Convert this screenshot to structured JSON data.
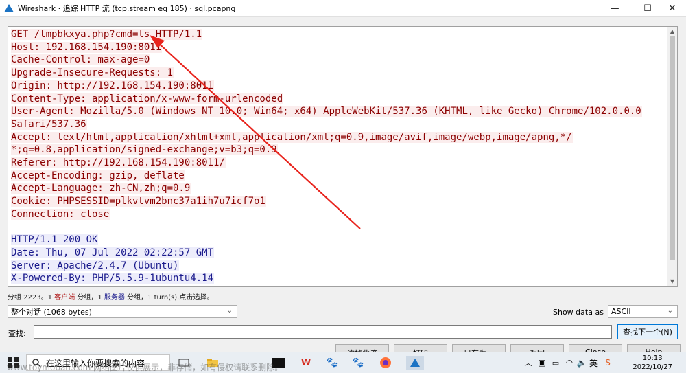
{
  "window": {
    "title": "Wireshark · 追踪 HTTP 流 (tcp.stream eq 185) · sql.pcapng",
    "controls": {
      "minimize": "—",
      "maximize": "☐",
      "close": "✕"
    }
  },
  "stream": {
    "client_lines": [
      "GET /tmpbkxya.php?cmd=ls HTTP/1.1",
      "Host: 192.168.154.190:8011",
      "Cache-Control: max-age=0",
      "Upgrade-Insecure-Requests: 1",
      "Origin: http://192.168.154.190:8011",
      "Content-Type: application/x-www-form-urlencoded",
      "User-Agent: Mozilla/5.0 (Windows NT 10.0; Win64; x64) AppleWebKit/537.36 (KHTML, like Gecko) Chrome/102.0.0.0",
      "Safari/537.36",
      "Accept: text/html,application/xhtml+xml,application/xml;q=0.9,image/avif,image/webp,image/apng,*/",
      "*;q=0.8,application/signed-exchange;v=b3;q=0.9",
      "Referer: http://192.168.154.190:8011/",
      "Accept-Encoding: gzip, deflate",
      "Accept-Language: zh-CN,zh;q=0.9",
      "Cookie: PHPSESSID=plkvtvm2bnc37a1ih7u7icf7o1",
      "Connection: close"
    ],
    "server_lines": [
      "HTTP/1.1 200 OK",
      "Date: Thu, 07 Jul 2022 02:22:57 GMT",
      "Server: Apache/2.4.7 (Ubuntu)",
      "X-Powered-By: PHP/5.5.9-1ubuntu4.14"
    ]
  },
  "summary": {
    "prefix": "分组 2223。1 ",
    "client_word": "客户端",
    "middle": " 分组，1 ",
    "server_word": "服务器",
    "suffix": " 分组，1 turn(s).点击选择。"
  },
  "controls": {
    "conversation_select": "整个对话 (1068 bytes)",
    "show_data_label": "Show data as",
    "show_data_value": "ASCII",
    "find_label": "查找:",
    "find_value": "",
    "find_next": "查找下一个(N)"
  },
  "buttons": [
    "滤掉此流",
    "打印",
    "另存为…",
    "返回",
    "Close",
    "Help"
  ],
  "taskbar": {
    "search_placeholder": "在这里输入你要搜索的内容",
    "time": "10:13",
    "date": "2022/10/27",
    "ime": "英"
  },
  "watermark": "www.toymoban.com 网络图片仅供展示，非存储，如有侵权请联系删除。",
  "colors": {
    "client_text": "#8b0000",
    "client_bg": "#fbeded",
    "server_text": "#1a1a8c",
    "server_bg": "#ededfb",
    "annotation_arrow": "#e8231c"
  }
}
